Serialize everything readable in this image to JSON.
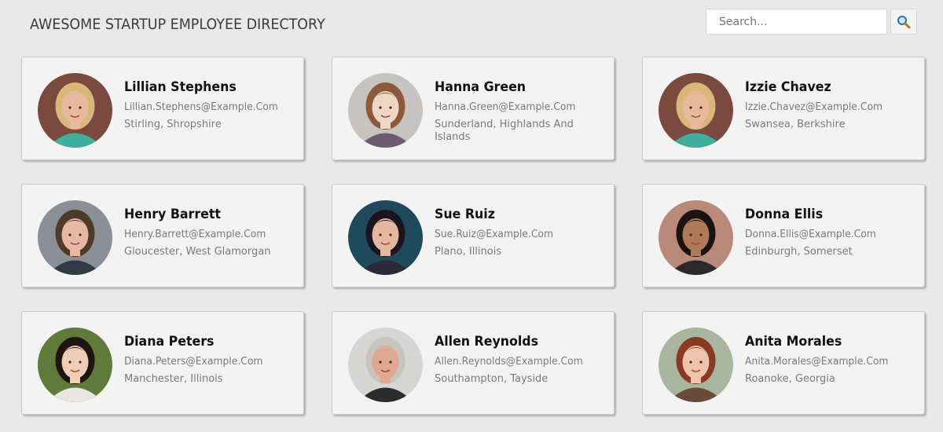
{
  "header": {
    "title": "AWESOME STARTUP EMPLOYEE DIRECTORY",
    "search_placeholder": "Search...",
    "search_button_icon": "search-icon"
  },
  "employees": [
    {
      "name": "Lillian Stephens",
      "email": "Lillian.Stephens@Example.Com",
      "location": "Stirling, Shropshire",
      "avatar": {
        "bg": "#7a4a3e",
        "skin": "#e9b99d",
        "hair": "#d9b679",
        "shirt": "#3fae9a"
      }
    },
    {
      "name": "Hanna Green",
      "email": "Hanna.Green@Example.Com",
      "location": "Sunderland, Highlands And Islands",
      "avatar": {
        "bg": "#c7c3c0",
        "skin": "#efd6c5",
        "hair": "#8a5a3a",
        "shirt": "#6c5a6e"
      }
    },
    {
      "name": "Izzie Chavez",
      "email": "Izzie.Chavez@Example.Com",
      "location": "Swansea, Berkshire",
      "avatar": {
        "bg": "#7a4a3e",
        "skin": "#e9b99d",
        "hair": "#d9b679",
        "shirt": "#3fae9a"
      }
    },
    {
      "name": "Henry Barrett",
      "email": "Henry.Barrett@Example.Com",
      "location": "Gloucester, West Glamorgan",
      "avatar": {
        "bg": "#8a9096",
        "skin": "#e8b9a2",
        "hair": "#4e3a2a",
        "shirt": "#2f3a45"
      }
    },
    {
      "name": "Sue Ruiz",
      "email": "Sue.Ruiz@Example.Com",
      "location": "Plano, Illinois",
      "avatar": {
        "bg": "#1f4a5c",
        "skin": "#e4b79e",
        "hair": "#1a1420",
        "shirt": "#2a2a3a"
      }
    },
    {
      "name": "Donna Ellis",
      "email": "Donna.Ellis@Example.Com",
      "location": "Edinburgh, Somerset",
      "avatar": {
        "bg": "#b98a7a",
        "skin": "#b07a5a",
        "hair": "#1c1210",
        "shirt": "#2a2a2a"
      }
    },
    {
      "name": "Diana Peters",
      "email": "Diana.Peters@Example.Com",
      "location": "Manchester, Illinois",
      "avatar": {
        "bg": "#5f7a3a",
        "skin": "#efcdb6",
        "hair": "#1e1410",
        "shirt": "#ebe6df"
      }
    },
    {
      "name": "Allen Reynolds",
      "email": "Allen.Reynolds@Example.Com",
      "location": "Southampton, Tayside",
      "avatar": {
        "bg": "#d6d6d4",
        "skin": "#e0a88f",
        "hair": "#c9c4bd",
        "shirt": "#2b2b2b"
      }
    },
    {
      "name": "Anita Morales",
      "email": "Anita.Morales@Example.Com",
      "location": "Roanoke, Georgia",
      "avatar": {
        "bg": "#a8b6a0",
        "skin": "#f0c4aa",
        "hair": "#8a3a22",
        "shirt": "#6a4a3a"
      }
    }
  ]
}
